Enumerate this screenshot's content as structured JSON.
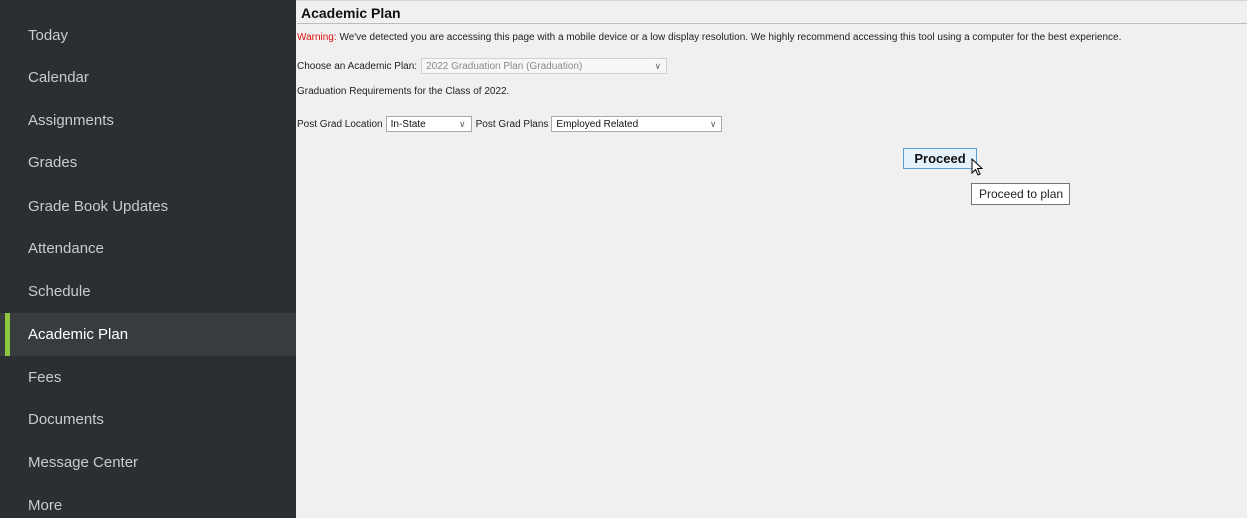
{
  "sidebar": {
    "items": [
      {
        "label": "Today",
        "active": false
      },
      {
        "label": "Calendar",
        "active": false
      },
      {
        "label": "Assignments",
        "active": false
      },
      {
        "label": "Grades",
        "active": false
      },
      {
        "label": "Grade Book Updates",
        "active": false
      },
      {
        "label": "Attendance",
        "active": false
      },
      {
        "label": "Schedule",
        "active": false
      },
      {
        "label": "Academic Plan",
        "active": true
      },
      {
        "label": "Fees",
        "active": false
      },
      {
        "label": "Documents",
        "active": false
      },
      {
        "label": "Message Center",
        "active": false
      },
      {
        "label": "More",
        "active": false
      }
    ],
    "accent_color": "#8dc63f"
  },
  "main": {
    "title": "Academic Plan",
    "warning": {
      "label": "Warning:",
      "text": "We've detected you are accessing this page with a mobile device or a low display resolution. We highly recommend accessing this tool using a computer for the best experience."
    },
    "choose_plan": {
      "label": "Choose an Academic Plan:",
      "selected": "2022 Graduation Plan (Graduation)"
    },
    "requirements_text": "Graduation Requirements for the Class of 2022.",
    "post_grad": {
      "location_label": "Post Grad Location",
      "location_selected": "In-State",
      "plans_label": "Post Grad Plans",
      "plans_selected": "Employed Related"
    },
    "proceed_label": "Proceed",
    "tooltip": "Proceed to plan"
  }
}
